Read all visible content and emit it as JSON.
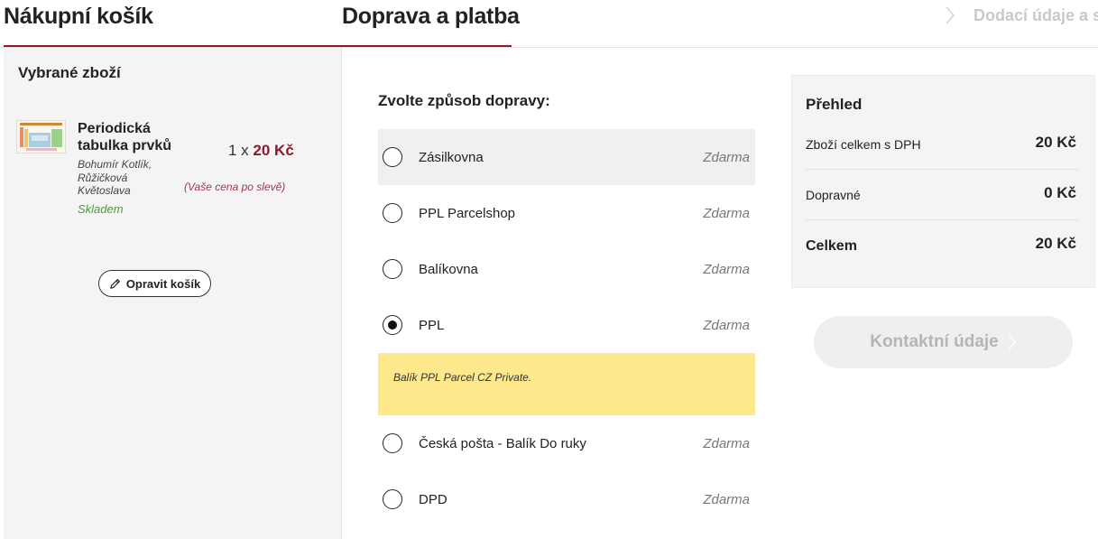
{
  "header": {
    "step_cart": "Nákupní košík",
    "step_shipping": "Doprava a platba",
    "step_next": "Dodací údaje a so"
  },
  "cart": {
    "title": "Vybrané zboží",
    "item": {
      "name": "Periodická tabulka prvků",
      "author": "Bohumír Kotlík, Růžičková Květoslava",
      "stock": "Skladem",
      "quantity": "1 x",
      "price": "20 Kč",
      "note": "(Vaše cena po slevě)"
    },
    "edit_button": "Opravit košík"
  },
  "shipping": {
    "title": "Zvolte způsob dopravy:",
    "options": [
      {
        "label": "Zásilkovna",
        "price": "Zdarma",
        "selected": false
      },
      {
        "label": "PPL Parcelshop",
        "price": "Zdarma",
        "selected": false
      },
      {
        "label": "Balíkovna",
        "price": "Zdarma",
        "selected": false
      },
      {
        "label": "PPL",
        "price": "Zdarma",
        "selected": true
      },
      {
        "label": "Česká pošta - Balík Do ruky",
        "price": "Zdarma",
        "selected": false
      },
      {
        "label": "DPD",
        "price": "Zdarma",
        "selected": false
      }
    ],
    "selected_info": "Balík PPL Parcel CZ Private."
  },
  "summary": {
    "title": "Přehled",
    "rows": [
      {
        "label": "Zboží celkem s DPH",
        "value": "20 Kč"
      },
      {
        "label": "Dopravné",
        "value": "0 Kč"
      },
      {
        "label": "Celkem",
        "value": "20 Kč"
      }
    ],
    "continue_button": "Kontaktní údaje"
  },
  "colors": {
    "accent": "#8b1a2b",
    "stock": "#4a9b3a",
    "info_background": "#fde98b",
    "panel_background": "#f4f4f4"
  }
}
